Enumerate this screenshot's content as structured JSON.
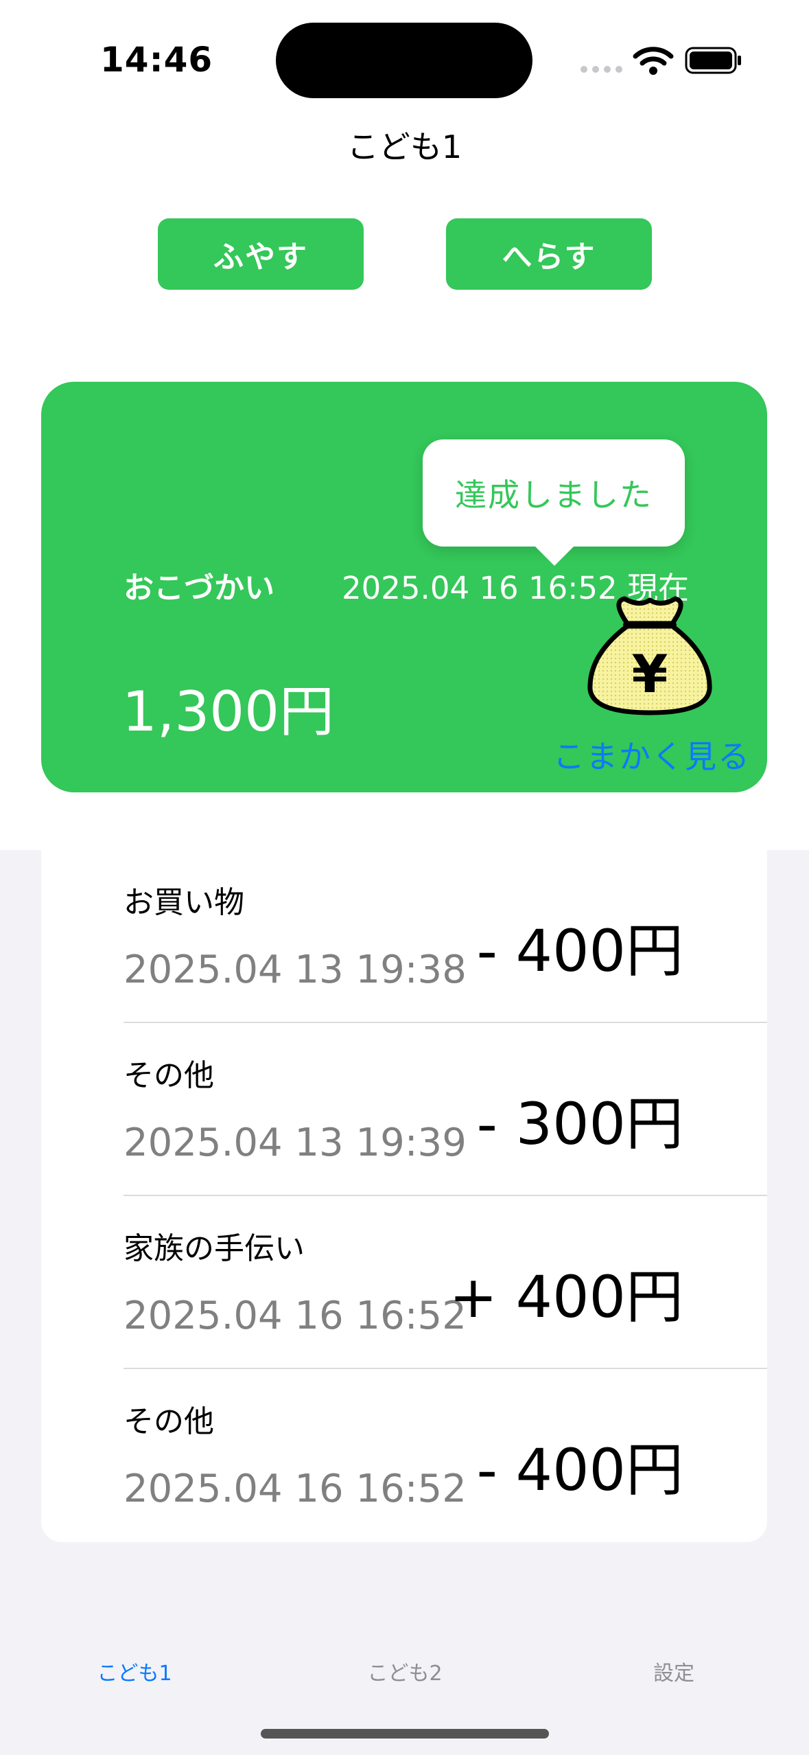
{
  "status_bar": {
    "time": "14:46"
  },
  "header": {
    "title": "こども1"
  },
  "actions": {
    "increase_label": "ふやす",
    "decrease_label": "へらす"
  },
  "balance_card": {
    "label": "おこづかい",
    "date": "2025.04 16 16:52 現在",
    "amount": "1,300円",
    "detail_link": "こまかく見る",
    "tooltip": "達成しました",
    "icon": "money-bag-yen-icon"
  },
  "transactions": [
    {
      "category": "お買い物",
      "date": "2025.04 13 19:38",
      "amount": "- 400円"
    },
    {
      "category": "その他",
      "date": "2025.04 13 19:39",
      "amount": "- 300円"
    },
    {
      "category": "家族の手伝い",
      "date": "2025.04 16 16:52",
      "amount": "+ 400円"
    },
    {
      "category": "その他",
      "date": "2025.04 16 16:52",
      "amount": "- 400円"
    }
  ],
  "tab_bar": {
    "tabs": [
      {
        "label": "こども1",
        "active": true
      },
      {
        "label": "こども2",
        "active": false
      },
      {
        "label": "設定",
        "active": false
      }
    ]
  },
  "colors": {
    "accent": "#34c759",
    "link": "#0a7aff",
    "secondary_text": "#808080"
  }
}
